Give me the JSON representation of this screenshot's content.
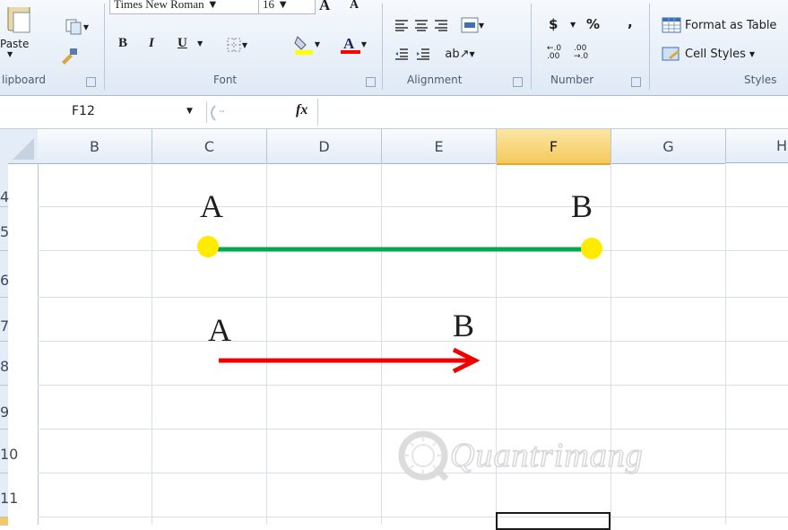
{
  "ribbon": {
    "clipboard": {
      "paste_label": "Paste",
      "group_label": "lipboard"
    },
    "font": {
      "font_name": "Times New Roman",
      "font_size": "16",
      "bold": "B",
      "italic": "I",
      "underline": "U",
      "grow": "A",
      "shrink": "A",
      "group_label": "Font"
    },
    "alignment": {
      "group_label": "Alignment"
    },
    "number": {
      "currency": "$",
      "percent": "%",
      "comma": ",",
      "inc_decimal": "←.0 .00",
      "dec_decimal": ".00 →.0",
      "group_label": "Number"
    },
    "styles": {
      "format_table": "Format as Table",
      "cell_styles": "Cell Styles",
      "group_label": "Styles"
    }
  },
  "formula_bar": {
    "name_box": "F12",
    "fx": "fx",
    "value": ""
  },
  "columns": [
    "B",
    "C",
    "D",
    "E",
    "F",
    "G",
    "H"
  ],
  "selected_column": "F",
  "rows": [
    "4",
    "5",
    "6",
    "7",
    "8",
    "9",
    "10",
    "11"
  ],
  "drawing": {
    "segment": {
      "label_a": "A",
      "label_b": "B",
      "line_color": "#00a84f",
      "point_color": "#ffeb00"
    },
    "vector": {
      "label_a": "A",
      "label_b": "B",
      "arrow_color": "#f00000"
    }
  },
  "watermark": "Quantrimang"
}
